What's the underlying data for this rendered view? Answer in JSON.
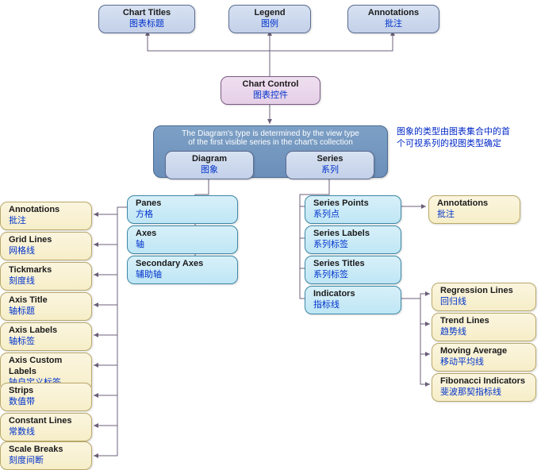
{
  "top": {
    "chartTitles": {
      "en": "Chart Titles",
      "zh": "图表标题"
    },
    "legend": {
      "en": "Legend",
      "zh": "图例"
    },
    "annotations": {
      "en": "Annotations",
      "zh": "批注"
    }
  },
  "control": {
    "en": "Chart Control",
    "zh": "图表控件"
  },
  "caption": {
    "line1": "The Diagram's type is determined by the view type",
    "line2": "of the first visible series in the chart's collection"
  },
  "sideNote": {
    "line1": "图象的类型由图表集合中的首",
    "line2": "个可视系列的视图类型确定"
  },
  "diagram": {
    "en": "Diagram",
    "zh": "图象"
  },
  "series": {
    "en": "Series",
    "zh": "系列"
  },
  "diagChildren": {
    "panes": {
      "en": "Panes",
      "zh": "方格"
    },
    "axes": {
      "en": "Axes",
      "zh": "轴"
    },
    "secondaryAxes": {
      "en": "Secondary Axes",
      "zh": "辅助轴"
    }
  },
  "axesChildren": {
    "annotations": {
      "en": "Annotations",
      "zh": "批注"
    },
    "gridLines": {
      "en": "Grid Lines",
      "zh": "网格线"
    },
    "tickmarks": {
      "en": "Tickmarks",
      "zh": "刻度线"
    },
    "axisTitle": {
      "en": "Axis Title",
      "zh": "轴标题"
    },
    "axisLabels": {
      "en": "Axis Labels",
      "zh": "轴标签"
    },
    "axisCustomLabels": {
      "en": "Axis Custom Labels",
      "zh": "轴自定义标签"
    },
    "strips": {
      "en": "Strips",
      "zh": "数值带"
    },
    "constantLines": {
      "en": "Constant Lines",
      "zh": "常数线"
    },
    "scaleBreaks": {
      "en": "Scale Breaks",
      "zh": "刻度间断"
    }
  },
  "seriesChildren": {
    "seriesPoints": {
      "en": "Series Points",
      "zh": "系列点"
    },
    "seriesLabels": {
      "en": "Series Labels",
      "zh": "系列标签"
    },
    "seriesTitles": {
      "en": "Series Titles",
      "zh": "系列标签"
    },
    "indicators": {
      "en": "Indicators",
      "zh": "指标线"
    }
  },
  "seriesPointsAnnotations": {
    "en": "Annotations",
    "zh": "批注"
  },
  "indicatorChildren": {
    "regressionLines": {
      "en": "Regression Lines",
      "zh": "回归线"
    },
    "trendLines": {
      "en": "Trend Lines",
      "zh": "趋势线"
    },
    "movingAverage": {
      "en": "Moving Average",
      "zh": "移动平均线"
    },
    "fibonacciIndicators": {
      "en": "Fibonacci Indicators",
      "zh": "斐波那契指标线"
    }
  }
}
